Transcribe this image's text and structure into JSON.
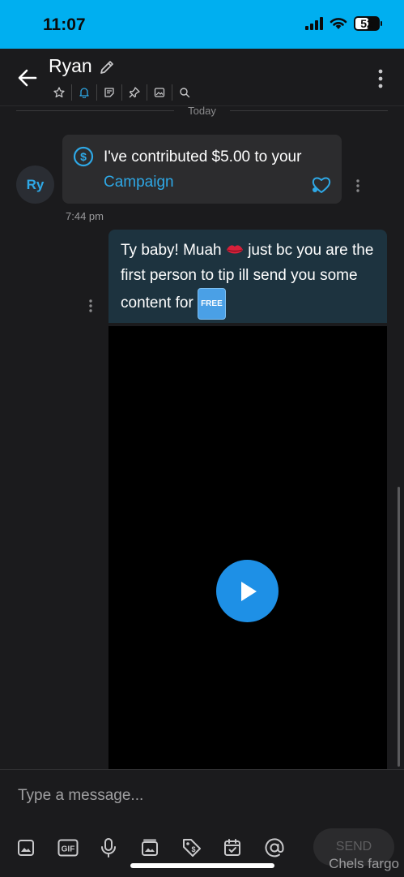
{
  "status_bar": {
    "time": "11:07",
    "battery": "52"
  },
  "header": {
    "name": "Ryan",
    "icons": [
      "star-icon",
      "bell-icon",
      "sticky-note-icon",
      "pin-icon",
      "image-icon",
      "search-icon"
    ],
    "active_icon": "bell-icon"
  },
  "divider_label": "Today",
  "received": {
    "avatar_initials": "Ry",
    "tip_text": "I've contributed $5.00 to your",
    "tip_link": "Campaign",
    "time": "7:44 pm"
  },
  "sent": {
    "text_before_emoji": "Ty baby! Muah",
    "text_after_emoji": "just bc you are the first person to tip ill send you some content for",
    "badge": "FREE"
  },
  "composer": {
    "placeholder": "Type a message...",
    "send_label": "SEND",
    "tools": [
      "image-icon",
      "gif-icon",
      "microphone-icon",
      "media-vault-icon",
      "price-tag-icon",
      "calendar-icon",
      "at-icon"
    ]
  },
  "watermark": "Chels fargo",
  "colors": {
    "accent": "#00aff0",
    "link": "#2ea8e6",
    "sent_bubble": "#1d333f",
    "received_bubble": "#2c2c2e"
  }
}
